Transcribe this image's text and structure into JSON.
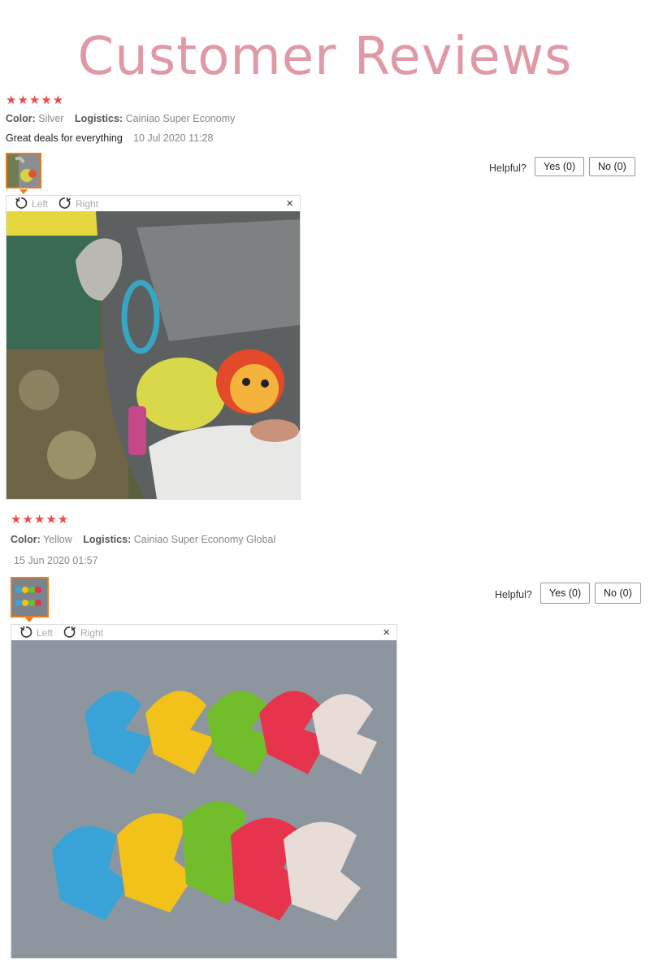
{
  "page": {
    "title": "Customer Reviews",
    "title_color": "#df9aa5"
  },
  "colors": {
    "star": "#f04848",
    "accent": "#f07a1a"
  },
  "reviews": [
    {
      "stars": "★★★★★",
      "color_label": "Color:",
      "color_value": "Silver",
      "logistics_label": "Logistics:",
      "logistics_value": "Cainiao Super Economy",
      "comment": "Great deals for everything",
      "date": "10 Jul 2020 11:28",
      "helpful_label": "Helpful?",
      "yes_label": "Yes (0)",
      "no_label": "No (0)",
      "rotate_left_label": "Left",
      "rotate_right_label": "Right",
      "close_icon": "×",
      "photo": "stroller toy on clip"
    },
    {
      "stars": "★★★★★",
      "color_label": "Color:",
      "color_value": "Yellow",
      "logistics_label": "Logistics:",
      "logistics_value": "Cainiao Super Economy Global",
      "comment": "",
      "date": "15 Jun 2020 01:57",
      "helpful_label": "Helpful?",
      "yes_label": "Yes (0)",
      "no_label": "No (0)",
      "rotate_left_label": "Left",
      "rotate_right_label": "Right",
      "close_icon": "×",
      "photo": "colorful stroller clips"
    }
  ]
}
